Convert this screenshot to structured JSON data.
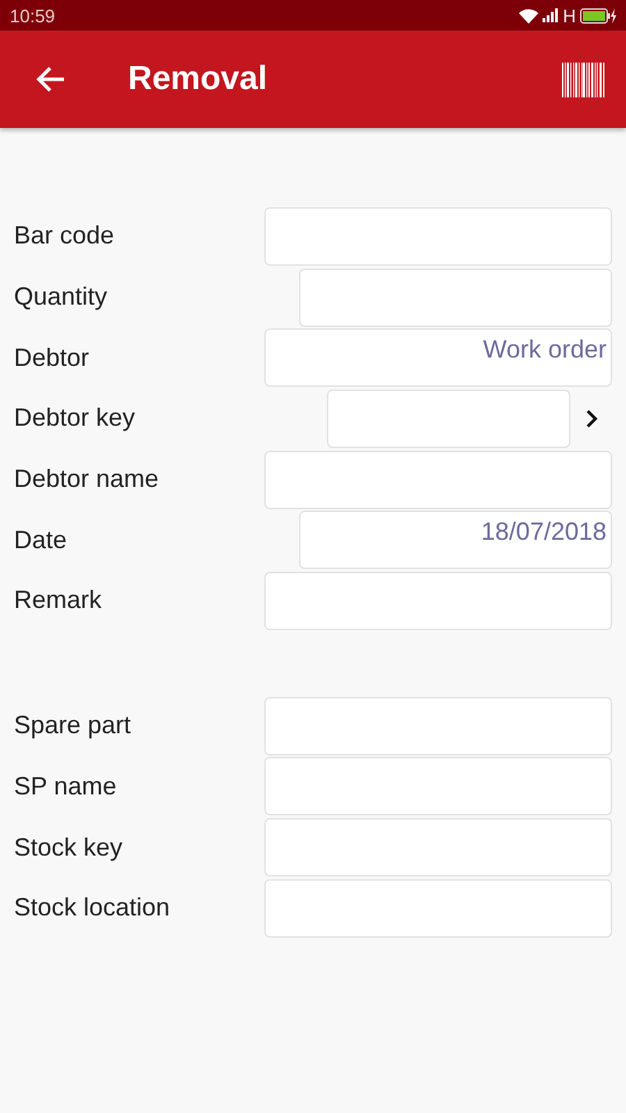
{
  "status_bar": {
    "time": "10:59",
    "network": "H"
  },
  "app_bar": {
    "title": "Removal"
  },
  "sections": [
    {
      "fields": [
        {
          "label": "Bar code",
          "kind": "text"
        },
        {
          "label": "Quantity",
          "kind": "number"
        },
        {
          "label": "Debtor",
          "kind": "choice",
          "value": "Work order"
        },
        {
          "label": "Debtor key",
          "kind": "lookup"
        },
        {
          "label": "Debtor name",
          "kind": "text"
        },
        {
          "label": "Date",
          "kind": "date",
          "value": "18/07/2018"
        },
        {
          "label": "Remark",
          "kind": "text"
        }
      ]
    },
    {
      "fields": [
        {
          "label": "Spare part",
          "kind": "text"
        },
        {
          "label": "SP name",
          "kind": "text"
        },
        {
          "label": "Stock key",
          "kind": "text"
        },
        {
          "label": "Stock location",
          "kind": "text"
        }
      ]
    }
  ]
}
